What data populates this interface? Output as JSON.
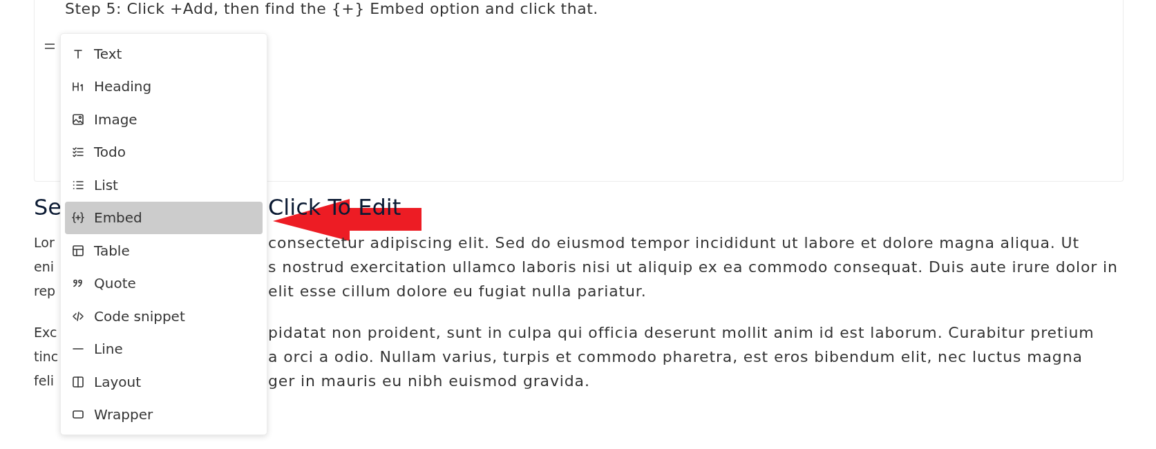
{
  "step_text": "Step 5: Click +Add, then find the {+} Embed option and click that.",
  "insert_menu": {
    "items": [
      {
        "kind": "text",
        "label": "Text",
        "selected": false
      },
      {
        "kind": "heading",
        "label": "Heading",
        "selected": false
      },
      {
        "kind": "image",
        "label": "Image",
        "selected": false
      },
      {
        "kind": "todo",
        "label": "Todo",
        "selected": false
      },
      {
        "kind": "list",
        "label": "List",
        "selected": false
      },
      {
        "kind": "embed",
        "label": "Embed",
        "selected": true
      },
      {
        "kind": "table",
        "label": "Table",
        "selected": false
      },
      {
        "kind": "quote",
        "label": "Quote",
        "selected": false
      },
      {
        "kind": "code",
        "label": "Code snippet",
        "selected": false
      },
      {
        "kind": "line",
        "label": "Line",
        "selected": false
      },
      {
        "kind": "layout",
        "label": "Layout",
        "selected": false
      },
      {
        "kind": "wrapper",
        "label": "Wrapper",
        "selected": false
      }
    ]
  },
  "section": {
    "heading": [
      "Se",
      "Click To Edit"
    ],
    "paragraphs": [
      {
        "lines": [
          [
            "Lor",
            "consectetur adipiscing elit. Sed do eiusmod tempor incididunt ut labore et dolore magna aliqua. Ut"
          ],
          [
            "eni",
            "s nostrud exercitation ullamco laboris nisi ut aliquip ex ea commodo consequat. Duis aute irure dolor in"
          ],
          [
            "rep",
            "elit esse cillum dolore eu fugiat nulla pariatur."
          ]
        ]
      },
      {
        "lines": [
          [
            "Exc",
            "pidatat non proident, sunt in culpa qui officia deserunt mollit anim id est laborum. Curabitur pretium"
          ],
          [
            "tinc",
            "a orci a odio. Nullam varius, turpis et commodo pharetra, est eros bibendum elit, nec luctus magna"
          ],
          [
            "feli",
            "ger in mauris eu nibh euismod gravida."
          ]
        ]
      }
    ]
  }
}
